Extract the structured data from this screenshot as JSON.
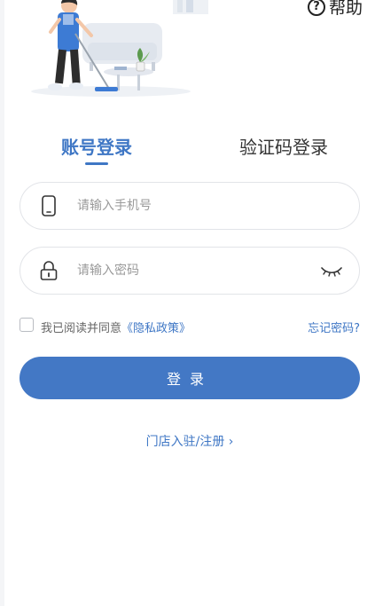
{
  "header": {
    "help_label": "帮助",
    "help_icon": "question-circle-icon"
  },
  "hero": {
    "illustration": "cleaning-worker-illustration"
  },
  "tabs": [
    {
      "label": "账号登录",
      "active": true
    },
    {
      "label": "验证码登录",
      "active": false
    }
  ],
  "form": {
    "phone": {
      "placeholder": "请输入手机号",
      "value": "",
      "icon": "phone-icon"
    },
    "password": {
      "placeholder": "请输入密码",
      "value": "",
      "icon": "lock-icon",
      "toggle_icon": "eye-closed-icon"
    }
  },
  "agreement": {
    "checked": false,
    "text": "我已阅读并同意",
    "policy_link": "《隐私政策》",
    "forgot_label": "忘记密码?"
  },
  "actions": {
    "login_label": "登录",
    "register_label": "门店入驻/注册",
    "register_arrow": "›"
  },
  "colors": {
    "accent": "#4378c5",
    "text_dark": "#333333",
    "placeholder": "#9a9a9a",
    "border": "#e2e4e8"
  }
}
